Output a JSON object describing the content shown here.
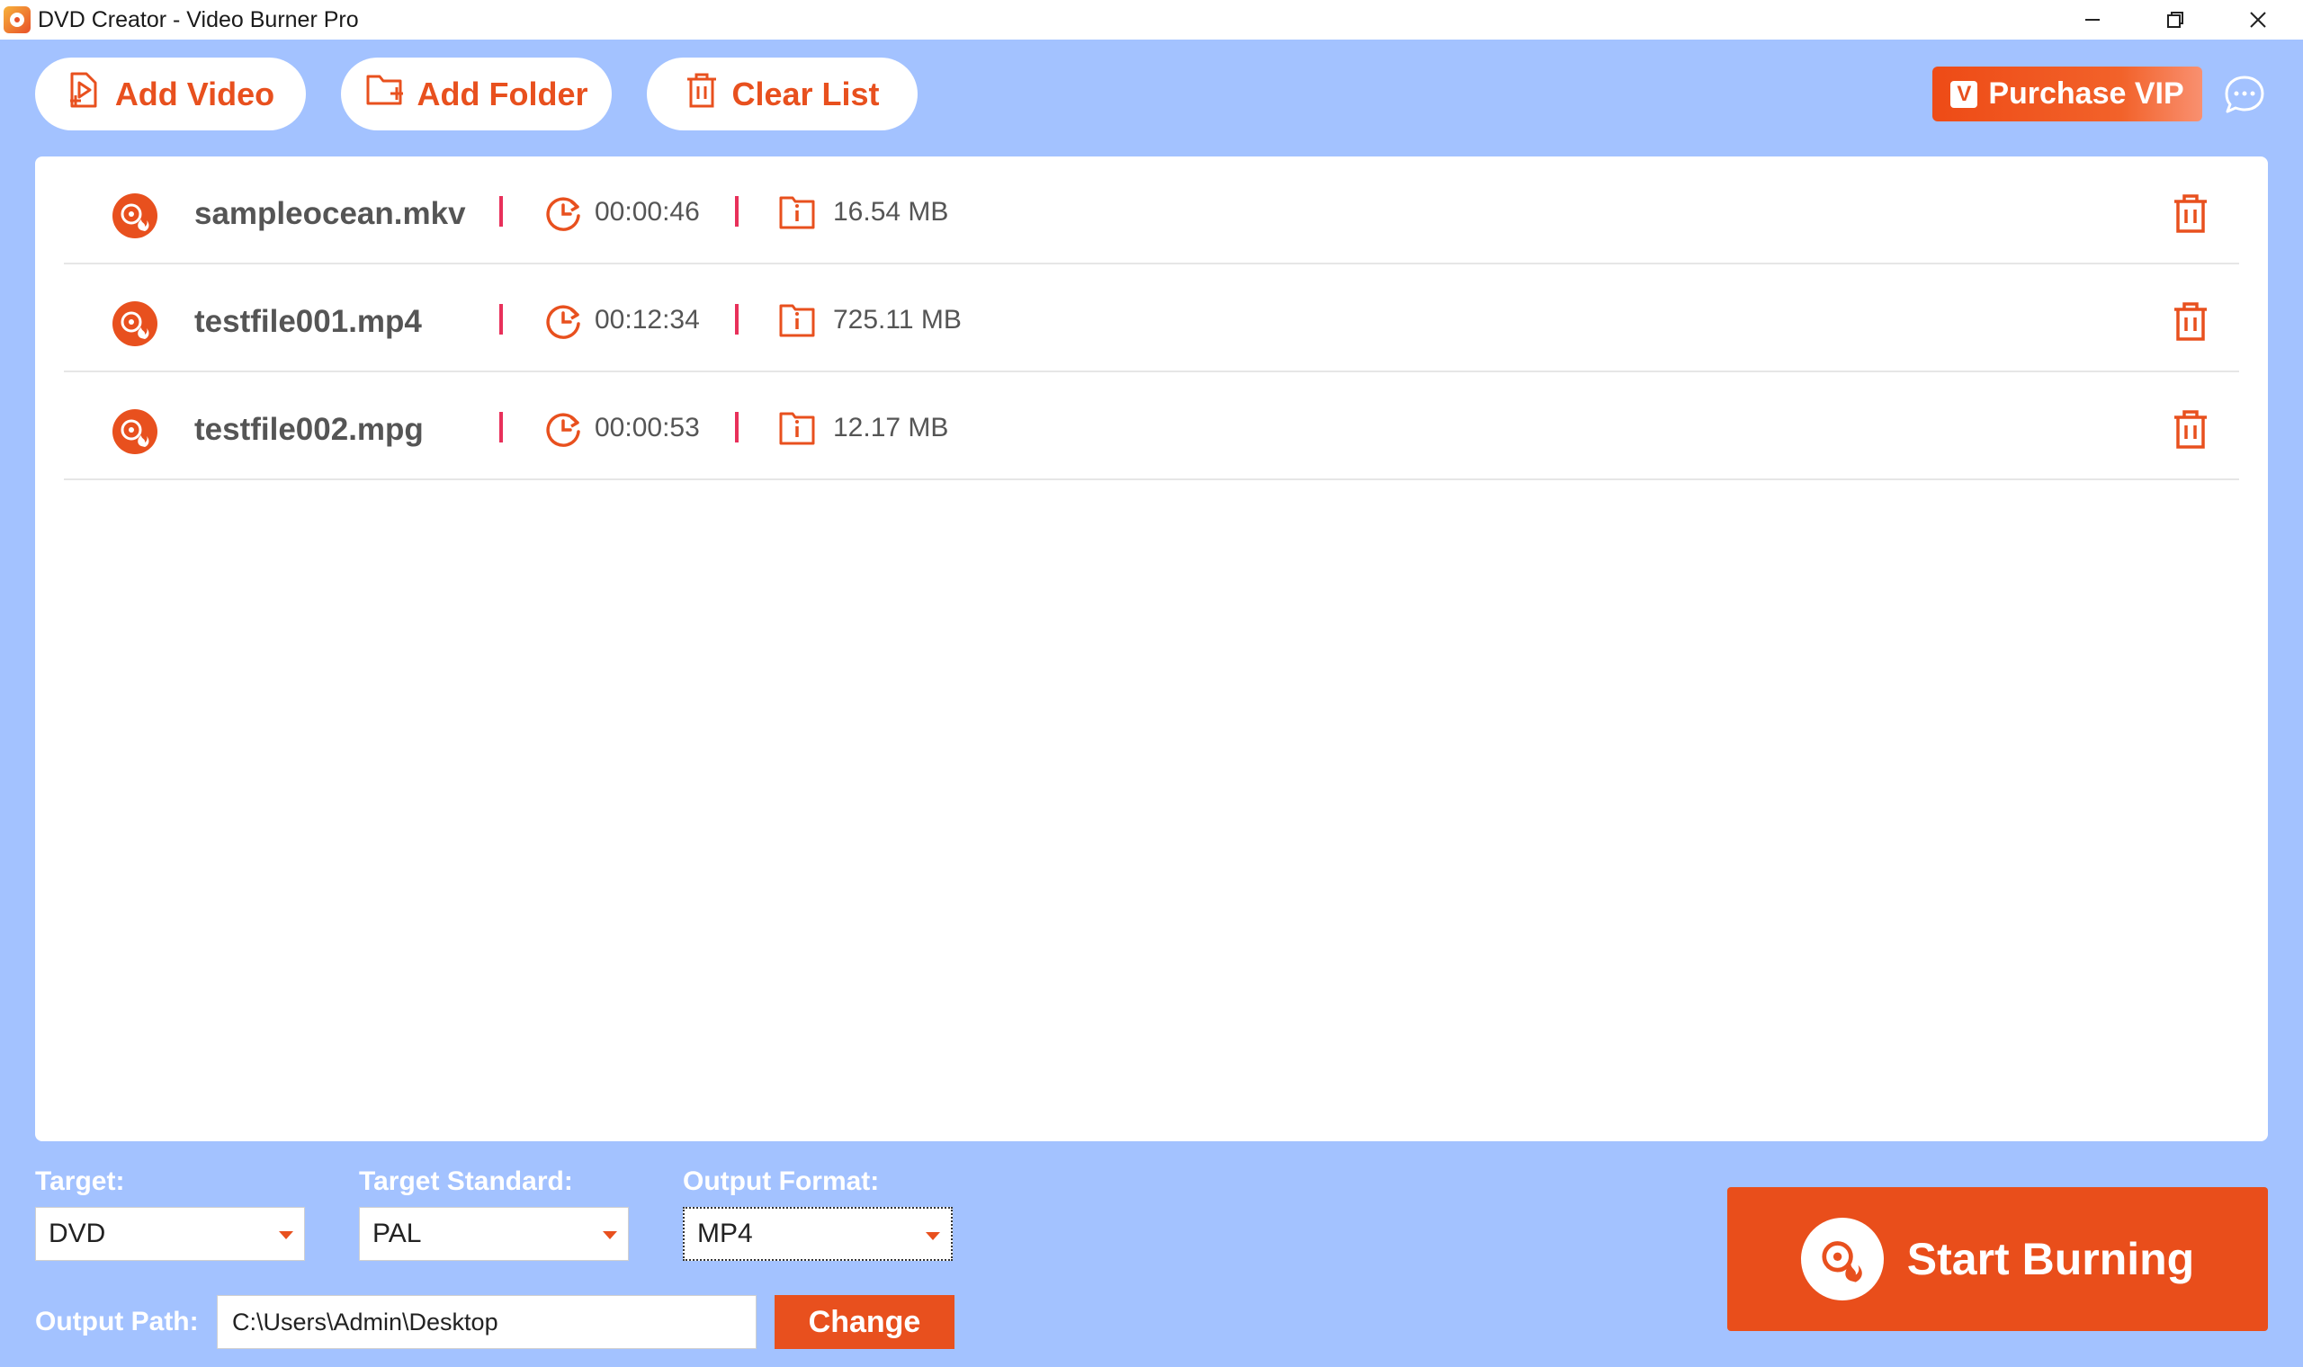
{
  "window": {
    "title": "DVD Creator - Video Burner Pro",
    "controls": [
      "minimize-icon",
      "restore-icon",
      "close-icon"
    ]
  },
  "toolbar": {
    "add_video_label": "Add Video",
    "add_folder_label": "Add Folder",
    "clear_list_label": "Clear List",
    "purchase_vip_label": "Purchase VIP",
    "vip_badge": "V"
  },
  "files": [
    {
      "name": "sampleocean.mkv",
      "duration": "00:00:46",
      "size": "16.54 MB"
    },
    {
      "name": "testfile001.mp4",
      "duration": "00:12:34",
      "size": "725.11 MB"
    },
    {
      "name": "testfile002.mpg",
      "duration": "00:00:53",
      "size": "12.17 MB"
    }
  ],
  "settings": {
    "target_label": "Target:",
    "target_value": "DVD",
    "standard_label": "Target Standard:",
    "standard_value": "PAL",
    "format_label": "Output Format:",
    "format_value": "MP4",
    "path_label": "Output Path:",
    "path_value": "C:\\Users\\Admin\\Desktop",
    "change_label": "Change"
  },
  "start_button_label": "Start Burning",
  "colors": {
    "accent": "#e8501e",
    "background": "#a3c2ff",
    "separator": "#e8305a"
  }
}
